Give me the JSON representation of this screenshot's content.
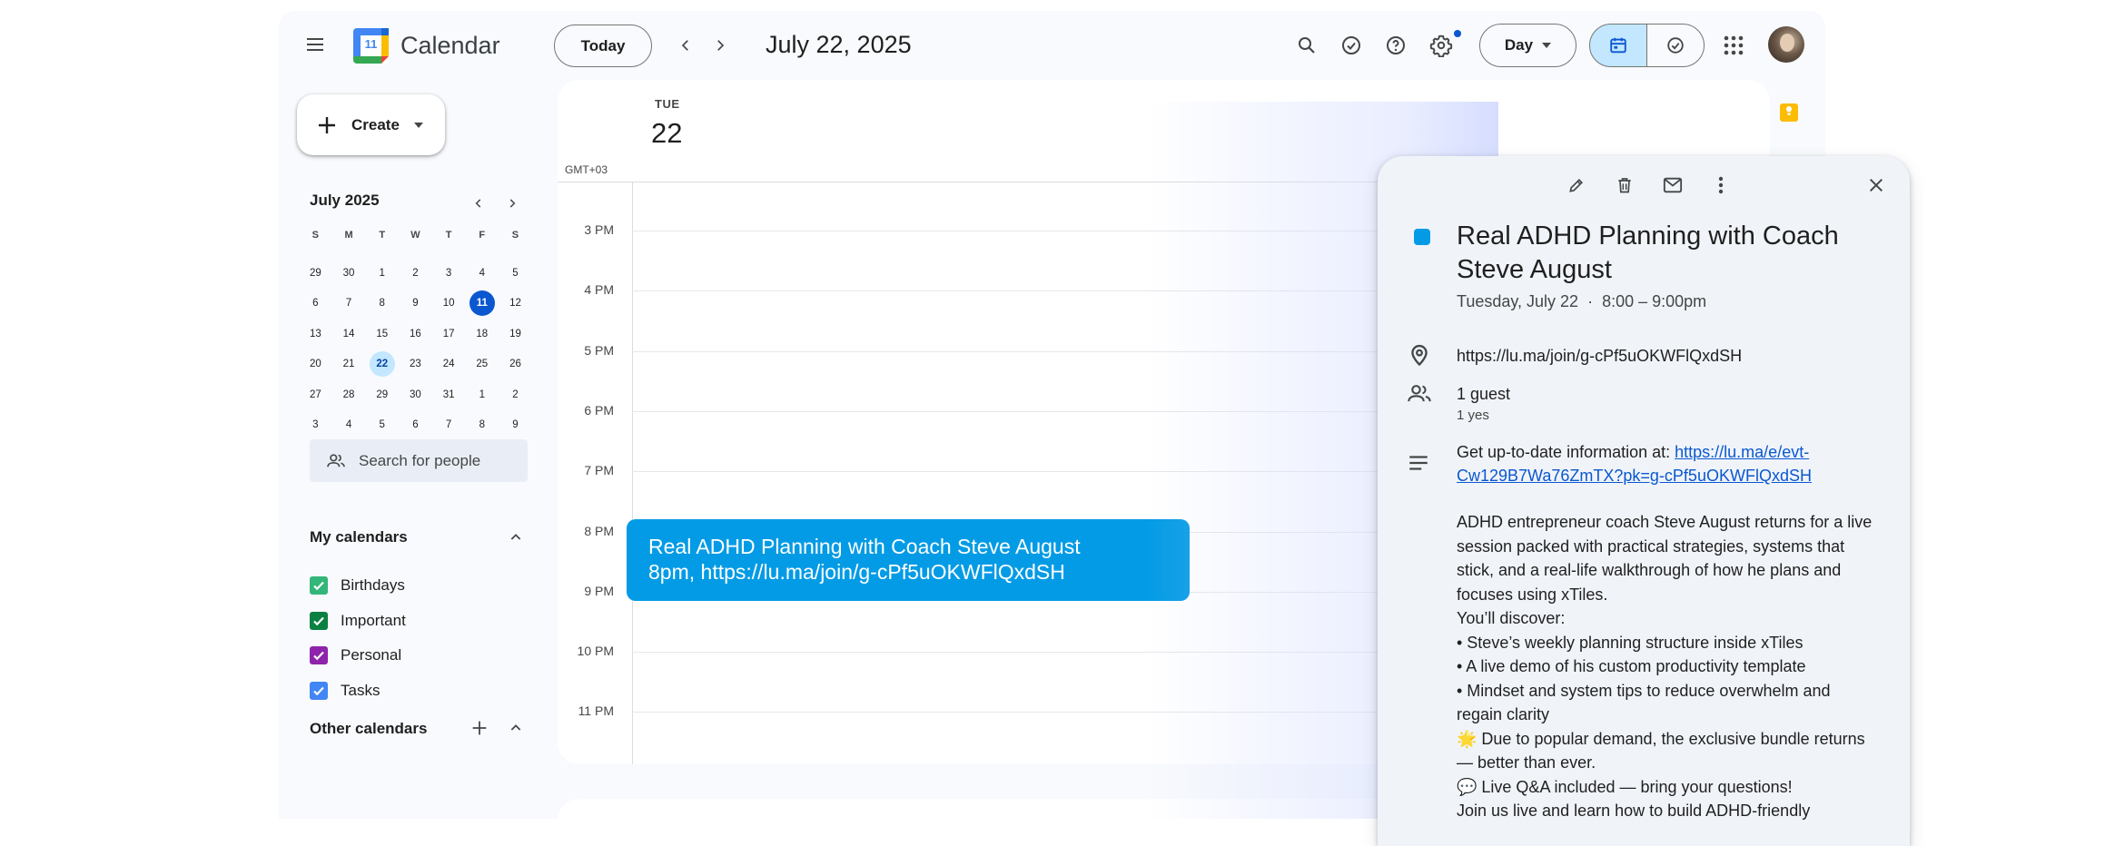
{
  "header": {
    "app_title": "Calendar",
    "logo_day": "11",
    "today_label": "Today",
    "date_title": "July 22, 2025",
    "view_label": "Day",
    "colors": {
      "accent": "#0b57d0",
      "selected_segment": "#c2e7ff"
    },
    "icons": [
      "menu-icon",
      "search-icon",
      "task-check-icon",
      "help-icon",
      "settings-icon",
      "calendar-view-icon",
      "tasks-view-icon",
      "apps-grid-icon"
    ]
  },
  "sidebar": {
    "create_label": "Create",
    "mini_calendar": {
      "title": "July 2025",
      "weekdays": [
        "S",
        "M",
        "T",
        "W",
        "T",
        "F",
        "S"
      ],
      "weeks": [
        [
          "29",
          "30",
          "1",
          "2",
          "3",
          "4",
          "5"
        ],
        [
          "6",
          "7",
          "8",
          "9",
          "10",
          "11",
          "12"
        ],
        [
          "13",
          "14",
          "15",
          "16",
          "17",
          "18",
          "19"
        ],
        [
          "20",
          "21",
          "22",
          "23",
          "24",
          "25",
          "26"
        ],
        [
          "27",
          "28",
          "29",
          "30",
          "31",
          "1",
          "2"
        ],
        [
          "3",
          "4",
          "5",
          "6",
          "7",
          "8",
          "9"
        ]
      ],
      "today": "11",
      "selected": "22"
    },
    "search_people_placeholder": "Search for people",
    "my_calendars_label": "My calendars",
    "calendars": [
      {
        "label": "Birthdays",
        "color": "#33b679"
      },
      {
        "label": "Important",
        "color": "#0b8043"
      },
      {
        "label": "Personal",
        "color": "#8e24aa"
      },
      {
        "label": "Tasks",
        "color": "#4285f4"
      }
    ],
    "other_calendars_label": "Other calendars"
  },
  "day_view": {
    "weekday": "TUE",
    "day_number": "22",
    "timezone": "GMT+03",
    "hours": [
      "3 PM",
      "4 PM",
      "5 PM",
      "6 PM",
      "7 PM",
      "8 PM",
      "9 PM",
      "10 PM",
      "11 PM"
    ],
    "event": {
      "title": "Real ADHD Planning with Coach Steve August",
      "subtitle": "8pm, https://lu.ma/join/g-cPf5uOKWFlQxdSH",
      "color": "#039be5"
    }
  },
  "popup": {
    "title": "Real ADHD Planning with Coach Steve August",
    "when": "Tuesday, July 22  ·  8:00 – 9:00pm",
    "location": "https://lu.ma/join/g-cPf5uOKWFlQxdSH",
    "guests": "1 guest",
    "guests_rsvp": "1 yes",
    "info_prefix": "Get up-to-date information at: ",
    "info_link_line1": "https://lu.ma/e/evt-",
    "info_link_line2": "Cw129B7Wa76ZmTX?pk=g-cPf5uOKWFlQxdSH",
    "description_lines": [
      "ADHD entrepreneur coach Steve August returns for a live",
      "session packed with practical strategies, systems that",
      "stick, and a real-life walkthrough of how he plans and",
      "focuses using xTiles.",
      "You’ll discover:",
      "• Steve’s weekly planning structure inside xTiles",
      "• A live demo of his custom productivity template",
      "• Mindset and system tips to reduce overwhelm and",
      "regain clarity",
      "🌟 Due to popular demand, the exclusive bundle returns",
      "— better than ever.",
      "💬 Live Q&A included — bring your questions!",
      "Join us live and learn how to build ADHD-friendly"
    ]
  }
}
